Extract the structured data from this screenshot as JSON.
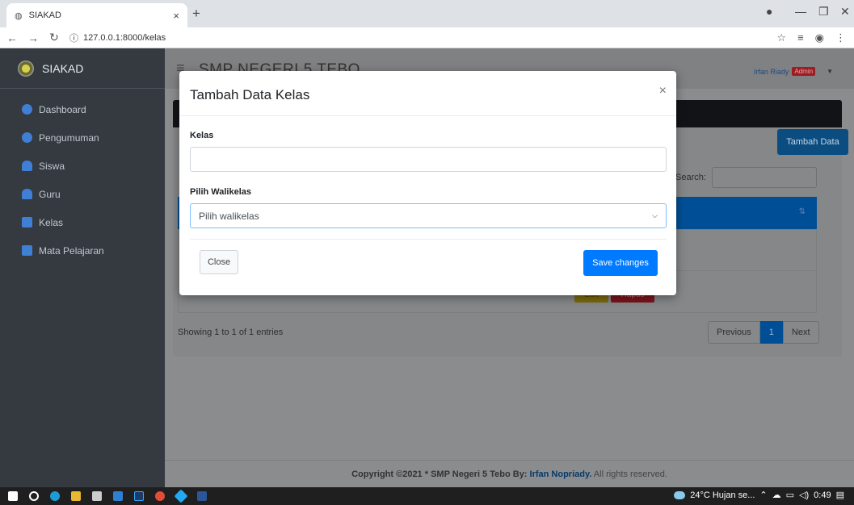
{
  "browser": {
    "tab_title": "SIAKAD",
    "tab_close": "×",
    "new_tab": "+",
    "url": "127.0.0.1:8000/kelas"
  },
  "sidebar": {
    "brand": "SIAKAD",
    "items": [
      {
        "label": "Dashboard",
        "icon": "dashboard-icon"
      },
      {
        "label": "Pengumuman",
        "icon": "gear-icon"
      },
      {
        "label": "Siswa",
        "icon": "user-icon"
      },
      {
        "label": "Guru",
        "icon": "users-icon"
      },
      {
        "label": "Kelas",
        "icon": "home-icon"
      },
      {
        "label": "Mata Pelajaran",
        "icon": "table-icon"
      }
    ]
  },
  "header": {
    "school_name": "SMP NEGERI 5 TEBO",
    "user_name": "Irfan Riady",
    "user_role": "Admin"
  },
  "page": {
    "add_button": "Tambah Data",
    "search_label": "Search:",
    "edit_button": "Edit",
    "delete_button": "Hapus",
    "showing": "Showing 1 to 1 of 1 entries",
    "pagination": {
      "previous": "Previous",
      "current": "1",
      "next": "Next"
    }
  },
  "footer": {
    "copyright": "Copyright ©2021 * SMP Negeri 5 Tebo By: ",
    "author": "Irfan Nopriady.",
    "rights": " All rights reserved."
  },
  "modal": {
    "title": "Tambah Data Kelas",
    "close_x": "×",
    "kelas_label": "Kelas",
    "kelas_value": "",
    "walikelas_label": "Pilih Walikelas",
    "walikelas_selected": "Pilih walikelas",
    "close_button": "Close",
    "save_button": "Save changes"
  },
  "taskbar": {
    "weather": "24°C  Hujan se...",
    "time": "0:49"
  },
  "colors": {
    "primary": "#007bff",
    "sidebar_bg": "#343a40",
    "admin_badge": "#dc3545"
  }
}
